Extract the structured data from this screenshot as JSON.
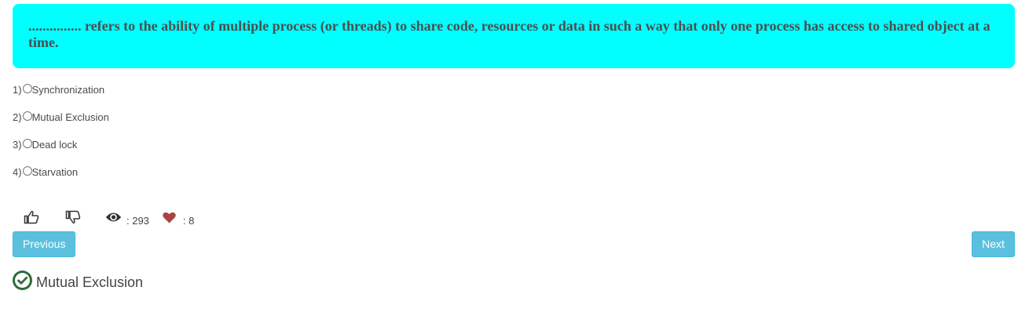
{
  "question": {
    "text": "............... refers to the ability of multiple process (or threads) to share code, resources or data in such a way that only one process has access to shared object at a time."
  },
  "options": [
    {
      "number": "1)",
      "label": "Synchronization"
    },
    {
      "number": "2)",
      "label": "Mutual Exclusion"
    },
    {
      "number": "3)",
      "label": "Dead lock"
    },
    {
      "number": "4)",
      "label": "Starvation"
    }
  ],
  "stats": {
    "views": ": 293",
    "likes": ": 8"
  },
  "icons": {
    "like": "thumbs-up-icon",
    "dislike": "thumbs-down-icon",
    "views": "eye-icon",
    "favorite": "heart-icon",
    "answer": "check-circle-icon"
  },
  "colors": {
    "question_bg": "#00ffff",
    "button_bg": "#5bc0de",
    "heart": "#a94442",
    "check": "#2e6b36"
  },
  "nav": {
    "previous_label": "Previous",
    "next_label": "Next"
  },
  "answer": {
    "text": "Mutual Exclusion"
  }
}
